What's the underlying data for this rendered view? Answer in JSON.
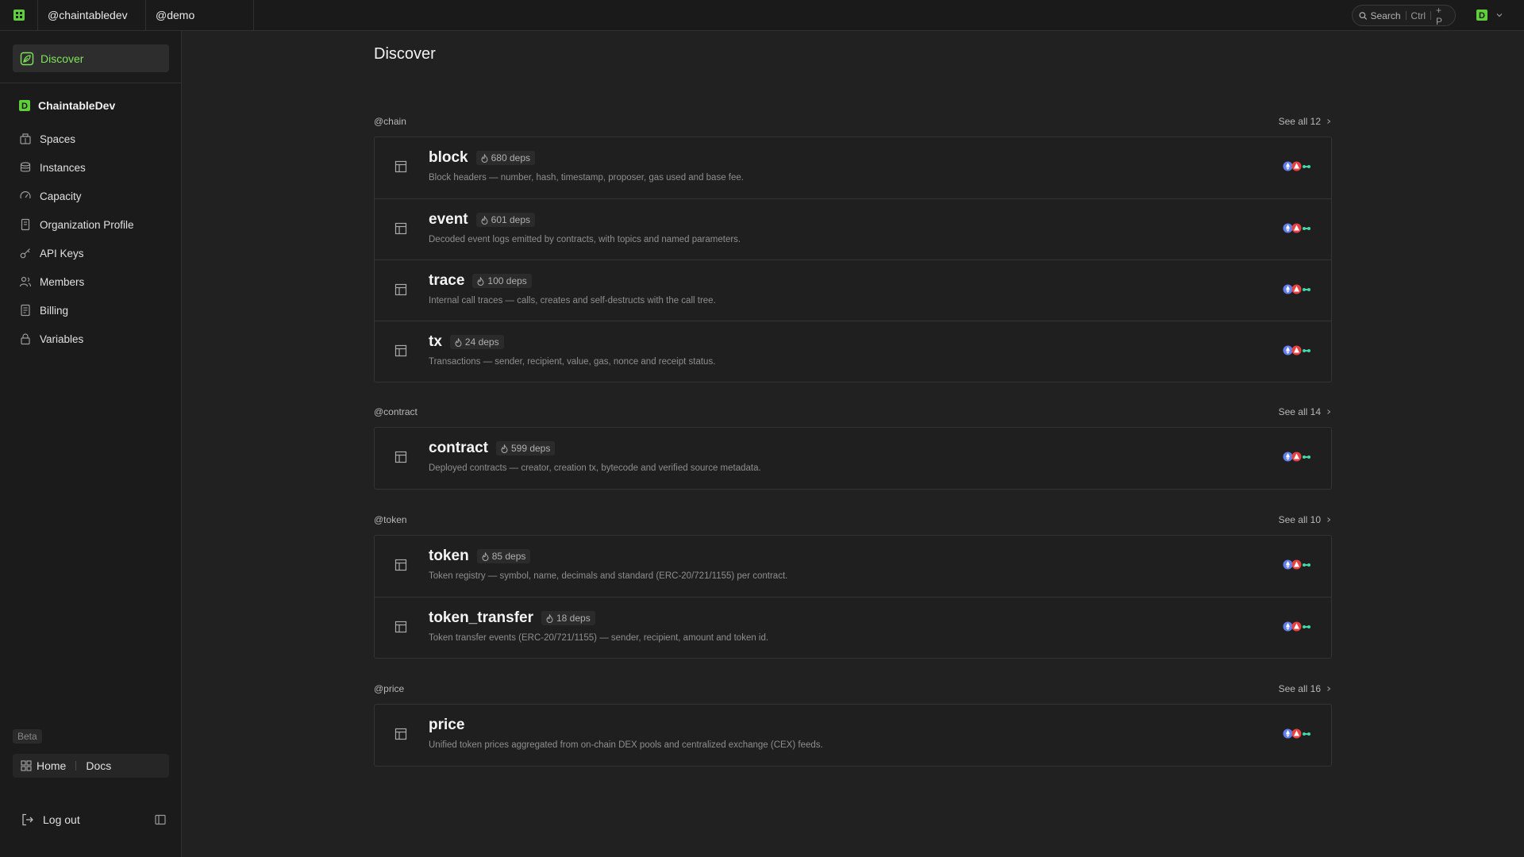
{
  "topbar": {
    "workspaces": [
      "@chaintabledev",
      "@demo"
    ],
    "search_label": "Search",
    "search_shortcut_mod": "Ctrl",
    "search_shortcut_key": "+ P",
    "avatar_letter": "D"
  },
  "sidebar": {
    "discover_label": "Discover",
    "org_name": "ChaintableDev",
    "org_letter": "D",
    "items": [
      {
        "label": "Spaces",
        "icon": "spaces-icon"
      },
      {
        "label": "Instances",
        "icon": "instances-icon"
      },
      {
        "label": "Capacity",
        "icon": "gauge-icon"
      },
      {
        "label": "Organization Profile",
        "icon": "profile-icon"
      },
      {
        "label": "API Keys",
        "icon": "key-icon"
      },
      {
        "label": "Members",
        "icon": "members-icon"
      },
      {
        "label": "Billing",
        "icon": "billing-icon"
      },
      {
        "label": "Variables",
        "icon": "lock-icon"
      }
    ],
    "beta_label": "Beta",
    "home_label": "Home",
    "docs_label": "Docs",
    "logout_label": "Log out"
  },
  "main": {
    "title": "Discover",
    "sections": [
      {
        "name": "@chain",
        "see_all": "See all 12",
        "cards": [
          {
            "name": "block",
            "deps": "680 deps",
            "desc": "Block headers — number, hash, timestamp, proposer, gas used and base fee."
          },
          {
            "name": "event",
            "deps": "601 deps",
            "desc": "Decoded event logs emitted by contracts, with topics and named parameters."
          },
          {
            "name": "trace",
            "deps": "100 deps",
            "desc": "Internal call traces — calls, creates and self-destructs with the call tree."
          },
          {
            "name": "tx",
            "deps": "24 deps",
            "desc": "Transactions — sender, recipient, value, gas, nonce and receipt status."
          }
        ]
      },
      {
        "name": "@contract",
        "see_all": "See all 14",
        "cards": [
          {
            "name": "contract",
            "deps": "599 deps",
            "desc": "Deployed contracts — creator, creation tx, bytecode and verified source metadata."
          }
        ]
      },
      {
        "name": "@token",
        "see_all": "See all 10",
        "cards": [
          {
            "name": "token",
            "deps": "85 deps",
            "desc": "Token registry — symbol, name, decimals and standard (ERC-20/721/1155) per contract."
          },
          {
            "name": "token_transfer",
            "deps": "18 deps",
            "desc": "Token transfer events (ERC-20/721/1155) — sender, recipient, amount and token id."
          }
        ]
      },
      {
        "name": "@price",
        "see_all": "See all 16",
        "cards": [
          {
            "name": "price",
            "deps": "",
            "desc": "Unified token prices aggregated from on-chain DEX pools and centralized exchange (CEX) feeds."
          }
        ]
      }
    ]
  },
  "colors": {
    "accent": "#7fe35c",
    "chain_blue": "#627eea",
    "chain_red": "#e84142",
    "chain_teal": "#3fd9a8"
  }
}
